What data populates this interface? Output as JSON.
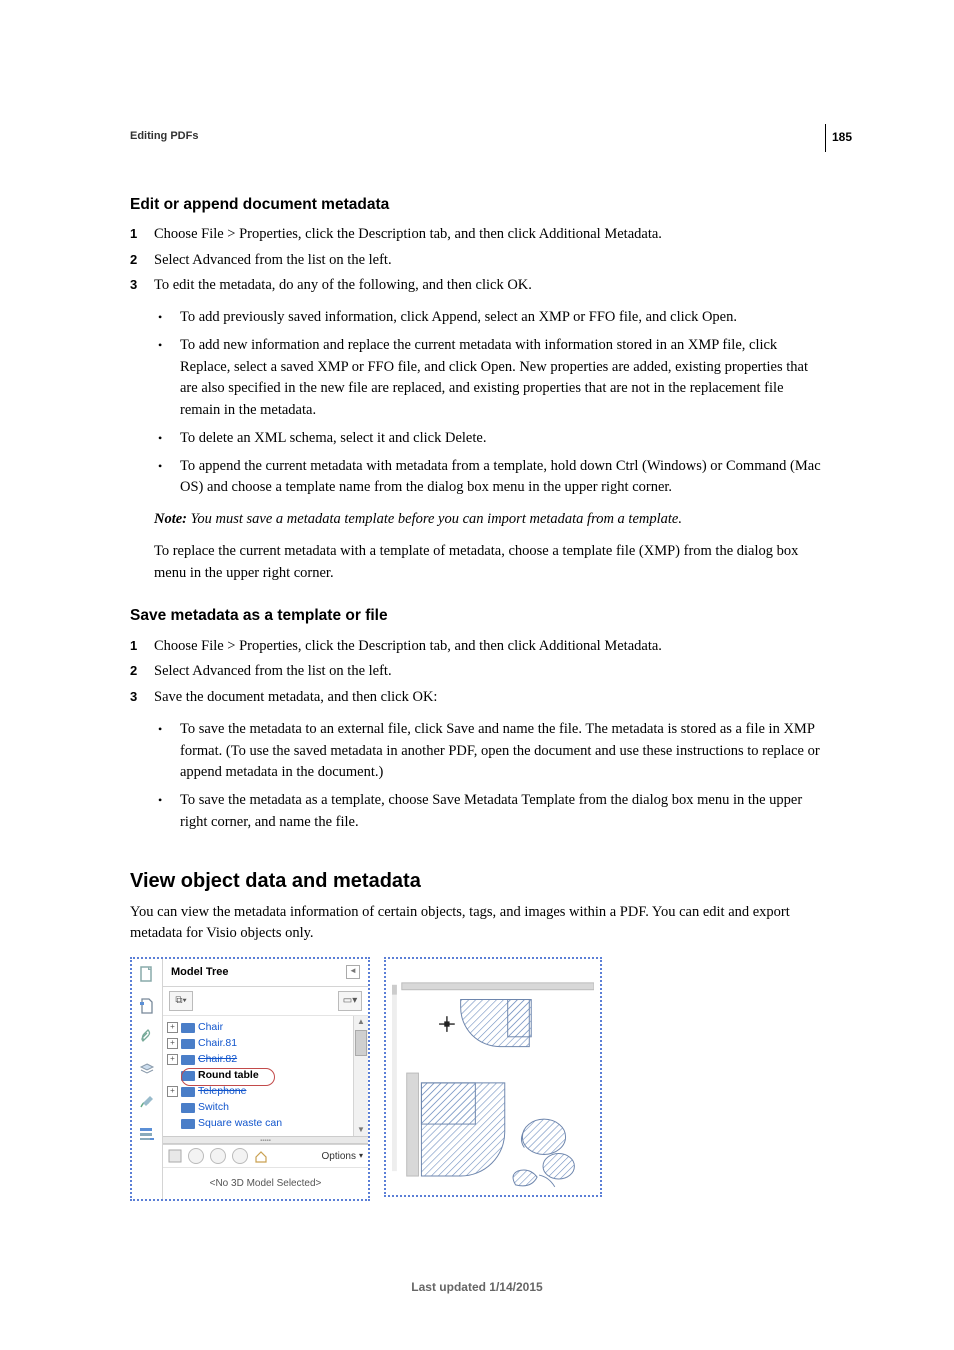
{
  "page_number": "185",
  "breadcrumb": "Editing PDFs",
  "h1": "Edit or append document metadata",
  "s1_step1": "Choose File > Properties, click the Description tab, and then click Additional Metadata.",
  "s1_step2": "Select Advanced from the list on the left.",
  "s1_step3": "To edit the metadata, do any of the following, and then click OK.",
  "s1_b1": "To add previously saved information, click Append, select an XMP or FFO file, and click Open.",
  "s1_b2": "To add new information and replace the current metadata with information stored in an XMP file, click Replace, select a saved XMP or FFO file, and click Open. New properties are added, existing properties that are also specified in the new file are replaced, and existing properties that are not in the replacement file remain in the metadata.",
  "s1_b3": "To delete an XML schema, select it and click Delete.",
  "s1_b4": "To append the current metadata with metadata from a template, hold down Ctrl (Windows) or Command (Mac OS) and choose a template name from the dialog box menu in the upper right corner.",
  "note_label": "Note:",
  "note_text": " You must save a metadata template before you can import metadata from a template.",
  "s1_after_note": "To replace the current metadata with a template of metadata, choose a template file (XMP) from the dialog box menu in the upper right corner.",
  "h2": "Save metadata as a template or file",
  "s2_step1": "Choose File > Properties, click the Description tab, and then click Additional Metadata.",
  "s2_step2": "Select Advanced from the list on the left.",
  "s2_step3": "Save the document metadata, and then click OK:",
  "s2_b1": "To save the metadata to an external file, click Save and name the file. The metadata is stored as a file in XMP format. (To use the saved metadata in another PDF, open the document and use these instructions to replace or append metadata in the document.)",
  "s2_b2": "To save the metadata as a template, choose Save Metadata Template from the dialog box menu in the upper right corner, and name the file.",
  "h3": "View object data and metadata",
  "h3_body": "You can view the metadata information of certain objects, tags, and images within a PDF. You can edit and export metadata for Visio objects only.",
  "tree": {
    "title": "Model Tree",
    "items": [
      {
        "label": "Chair",
        "expand": true
      },
      {
        "label": "Chair.81",
        "expand": true
      },
      {
        "label": "Chair.82",
        "expand": true,
        "struck": true
      },
      {
        "label": "Round table",
        "sel": true
      },
      {
        "label": "Telephone",
        "expand": true,
        "struck": true
      },
      {
        "label": "Switch"
      },
      {
        "label": "Square waste can"
      }
    ],
    "options": "Options",
    "no_model": "<No 3D Model Selected>"
  },
  "footer": "Last updated 1/14/2015"
}
